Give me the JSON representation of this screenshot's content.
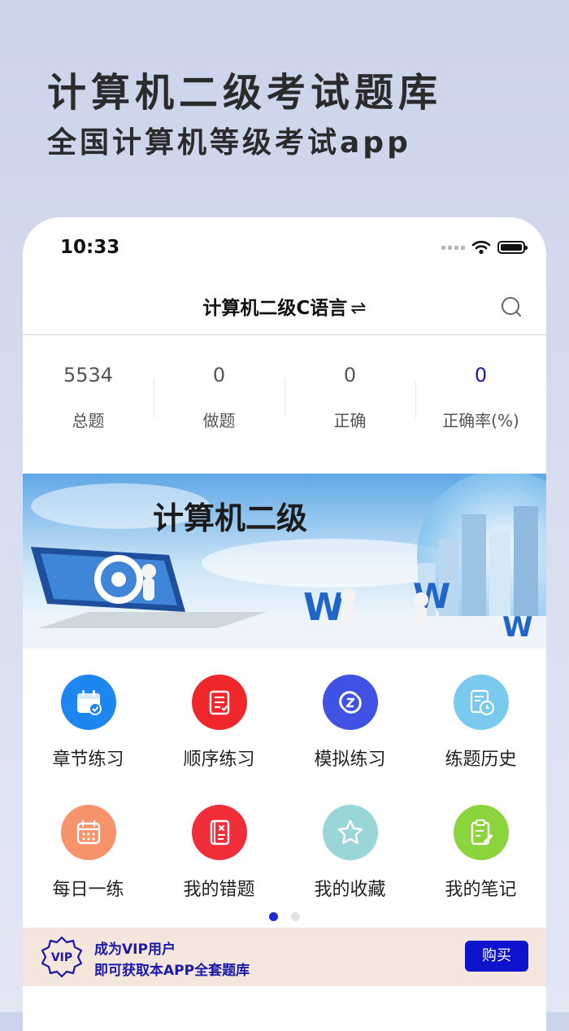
{
  "promo": {
    "title": "计算机二级考试题库",
    "subtitle": "全国计算机等级考试app"
  },
  "status_bar": {
    "time": "10:33"
  },
  "nav": {
    "title": "计算机二级C语言",
    "swap_glyph": "⇌",
    "search_icon": "search-icon"
  },
  "stats": [
    {
      "value": "5534",
      "label": "总题"
    },
    {
      "value": "0",
      "label": "做题"
    },
    {
      "value": "0",
      "label": "正确"
    },
    {
      "value": "0",
      "label": "正确率(%)"
    }
  ],
  "banner": {
    "text": "计算机二级"
  },
  "menu": [
    {
      "label": "章节练习",
      "icon": "calendar-check-icon",
      "color": "#1e86f0"
    },
    {
      "label": "顺序练习",
      "icon": "list-document-icon",
      "color": "#f0272a"
    },
    {
      "label": "模拟练习",
      "icon": "quiz-swirl-icon",
      "color": "#3f52e4"
    },
    {
      "label": "练题历史",
      "icon": "history-clock-icon",
      "color": "#7ac9ee"
    },
    {
      "label": "每日一练",
      "icon": "daily-calendar-icon",
      "color": "#f7936b"
    },
    {
      "label": "我的错题",
      "icon": "wrong-book-icon",
      "color": "#ef2e3a"
    },
    {
      "label": "我的收藏",
      "icon": "star-icon",
      "color": "#9ad6d8"
    },
    {
      "label": "我的笔记",
      "icon": "note-pencil-icon",
      "color": "#8bd43e"
    }
  ],
  "vip": {
    "badge": "VIP",
    "line1": "成为VIP用户",
    "line2": "即可获取本APP全套题库",
    "buy_label": "购买"
  },
  "colors": {
    "accent": "#0d14cc",
    "stat_highlight": "#1a1aa8",
    "vip_bar": "#f5e6dd"
  }
}
